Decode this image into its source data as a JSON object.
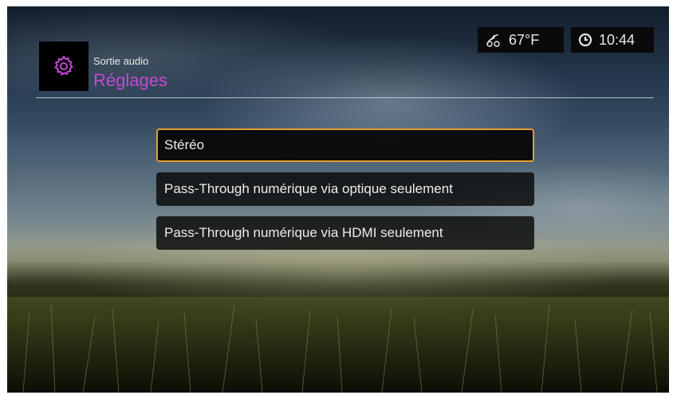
{
  "header": {
    "subtitle": "Sortie audio",
    "title": "Réglages",
    "icon": "gear-icon"
  },
  "status": {
    "weather_icon": "weather-icon",
    "temperature": "67°F",
    "clock_icon": "clock-icon",
    "time": "10:44"
  },
  "menu": {
    "items": [
      {
        "label": "Stéréo",
        "selected": true
      },
      {
        "label": "Pass-Through numérique via optique seulement",
        "selected": false
      },
      {
        "label": "Pass-Through numérique via HDMI seulement",
        "selected": false
      }
    ]
  },
  "colors": {
    "accent": "#c24bd6",
    "selection_border": "#e3a02c"
  }
}
